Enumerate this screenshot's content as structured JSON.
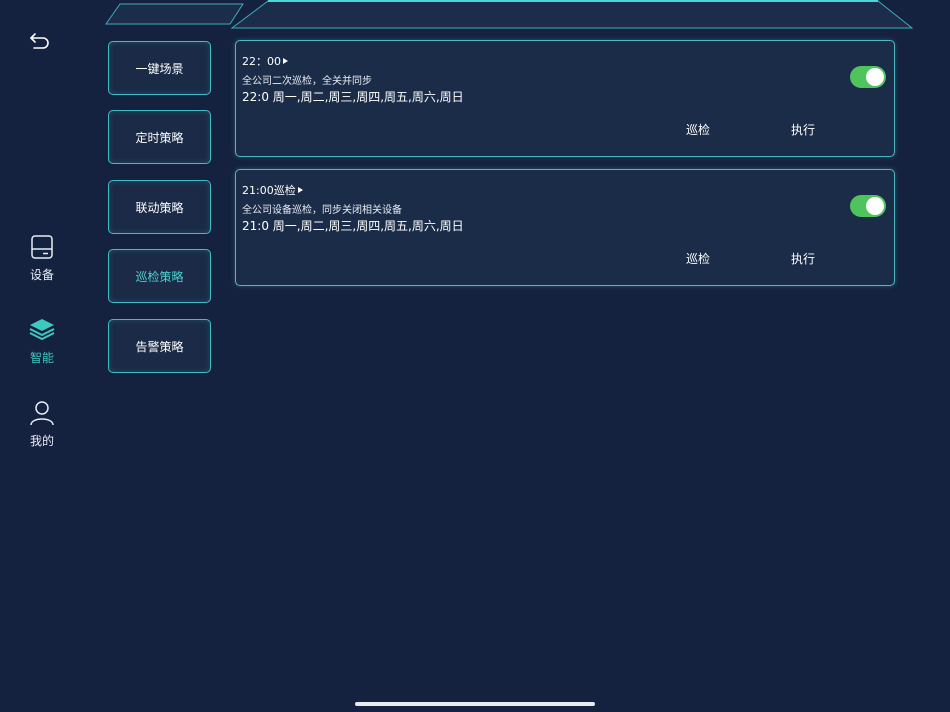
{
  "nav": {
    "back_icon": "back-arrow-icon",
    "items": [
      {
        "label": "设备",
        "icon": "device-icon"
      },
      {
        "label": "智能",
        "icon": "layers-icon"
      },
      {
        "label": "我的",
        "icon": "user-icon"
      }
    ],
    "active_index": 1
  },
  "categories": [
    {
      "label": "一键场景"
    },
    {
      "label": "定时策略"
    },
    {
      "label": "联动策略"
    },
    {
      "label": "巡检策略"
    },
    {
      "label": "告警策略"
    }
  ],
  "active_category": "巡检策略",
  "cards": [
    {
      "title": "22：00",
      "desc": "全公司二次巡检，全关并同步",
      "schedule": "22:0 周一,周二,周三,周四,周五,周六,周日",
      "enabled": true,
      "action1": "巡检",
      "action2": "执行"
    },
    {
      "title": "21:00巡检",
      "desc": "全公司设备巡检，同步关闭相关设备",
      "schedule": "21:0 周一,周二,周三,周四,周五,周六,周日",
      "enabled": true,
      "action1": "巡检",
      "action2": "执行"
    }
  ],
  "colors": {
    "background": "#15223f",
    "accent": "#3ec9c0",
    "border": "#3fbdc4",
    "toggle_on": "#4fc35c"
  }
}
